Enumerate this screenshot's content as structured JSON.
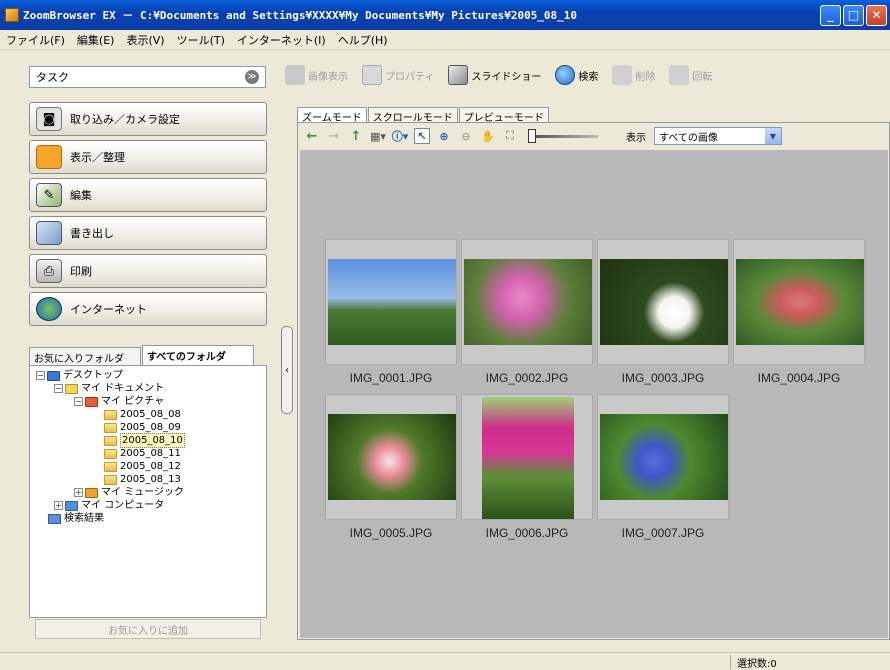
{
  "window": {
    "title": "ZoomBrowser EX － C:¥Documents and Settings¥XXXX¥My Documents¥My Pictures¥2005_08_10",
    "min_glyph": "_",
    "max_glyph": "□",
    "close_glyph": "✕"
  },
  "menu": [
    "ファイル(F)",
    "編集(E)",
    "表示(V)",
    "ツール(T)",
    "インターネット(I)",
    "ヘルプ(H)"
  ],
  "task_selector": {
    "label": "タスク",
    "chevron": "≫"
  },
  "tasks": [
    {
      "label": "取り込み／カメラ設定",
      "icon": "camera-icon"
    },
    {
      "label": "表示／整理",
      "icon": "folder-view-icon"
    },
    {
      "label": "編集",
      "icon": "edit-icon"
    },
    {
      "label": "書き出し",
      "icon": "export-icon"
    },
    {
      "label": "印刷",
      "icon": "printer-icon"
    },
    {
      "label": "インターネット",
      "icon": "globe-icon"
    }
  ],
  "folder_tabs": {
    "favorites": "お気に入りフォルダ",
    "all": "すべてのフォルダ"
  },
  "tree": [
    {
      "label": "デスクトップ",
      "pm": "−",
      "icon": "desk"
    },
    {
      "label": "マイ ドキュメント",
      "pm": "−",
      "icon": "doc"
    },
    {
      "label": "マイ ピクチャ",
      "pm": "−",
      "icon": "pic"
    },
    {
      "label": "2005_08_08",
      "pm": "",
      "icon": "fold"
    },
    {
      "label": "2005_08_09",
      "pm": "",
      "icon": "fold"
    },
    {
      "label": "2005_08_10",
      "pm": "",
      "icon": "fold",
      "selected": true
    },
    {
      "label": "2005_08_11",
      "pm": "",
      "icon": "fold"
    },
    {
      "label": "2005_08_12",
      "pm": "",
      "icon": "fold"
    },
    {
      "label": "2005_08_13",
      "pm": "",
      "icon": "fold"
    },
    {
      "label": "マイ ミュージック",
      "pm": "+",
      "icon": "mus"
    },
    {
      "label": "マイ コンピュータ",
      "pm": "+",
      "icon": "comp"
    },
    {
      "label": "検索結果",
      "pm": "",
      "icon": "srch"
    }
  ],
  "favorites_button": "お気に入りに追加",
  "collapse_glyph": "‹",
  "toolbar": {
    "view_image": "画像表示",
    "properties": "プロパティ",
    "slideshow": "スライドショー",
    "search": "検索",
    "delete": "削除",
    "rotate": "回転"
  },
  "view_tabs": [
    "ズームモード",
    "スクロールモード",
    "プレビューモード"
  ],
  "view_toolbar": {
    "show_label": "表示",
    "show_value": "すべての画像",
    "dd_glyph": "▼"
  },
  "images": [
    {
      "name": "IMG_0001.JPG"
    },
    {
      "name": "IMG_0002.JPG"
    },
    {
      "name": "IMG_0003.JPG"
    },
    {
      "name": "IMG_0004.JPG"
    },
    {
      "name": "IMG_0005.JPG"
    },
    {
      "name": "IMG_0006.JPG"
    },
    {
      "name": "IMG_0007.JPG"
    }
  ],
  "status": {
    "selected": "選択数:0"
  }
}
